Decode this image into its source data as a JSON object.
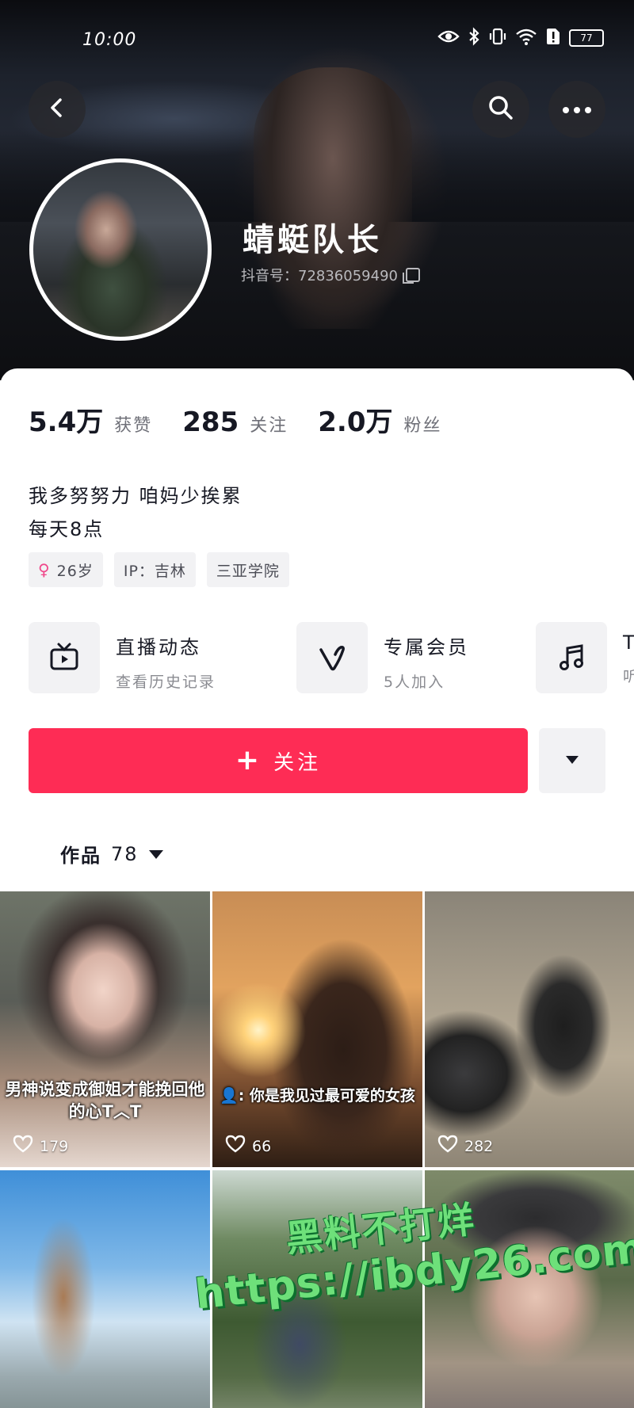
{
  "status_bar": {
    "time": "10:00",
    "battery": "77"
  },
  "profile": {
    "nickname": "蜻蜓队长",
    "uid_label": "抖音号：",
    "uid": "72836059490"
  },
  "stats": [
    {
      "value": "5.4万",
      "label": "获赞"
    },
    {
      "value": "285",
      "label": "关注"
    },
    {
      "value": "2.0万",
      "label": "粉丝"
    }
  ],
  "bio": {
    "line1": "我多努努力 咱妈少挨累",
    "line2": "每天8点"
  },
  "tags": {
    "age": "26岁",
    "ip": "IP：吉林",
    "school": "三亚学院"
  },
  "services": [
    {
      "icon": "tv-icon",
      "title": "直播动态",
      "subtitle": "查看历史记录"
    },
    {
      "icon": "v-icon",
      "title": "专属会员",
      "subtitle": "5人加入"
    },
    {
      "icon": "music-note-icon",
      "title": "Ta",
      "subtitle": "听"
    }
  ],
  "follow_button": {
    "label": "关注"
  },
  "works_tab": {
    "label": "作品",
    "count": "78"
  },
  "videos": [
    {
      "likes": "179",
      "caption": "男神说变成御姐才能挽回他的心T︿T"
    },
    {
      "likes": "66",
      "caption": "👤: 你是我见过最可爱的女孩"
    },
    {
      "likes": "282",
      "caption": ""
    },
    {
      "likes": "",
      "caption": ""
    },
    {
      "likes": "",
      "caption": ""
    },
    {
      "likes": "",
      "caption": ""
    }
  ],
  "watermark": {
    "line1": "黑料不打烊",
    "line2": "https://ibdy26.com"
  },
  "colors": {
    "accent": "#fe2c55",
    "card_bg": "#ffffff",
    "chip_bg": "#f2f2f4"
  }
}
